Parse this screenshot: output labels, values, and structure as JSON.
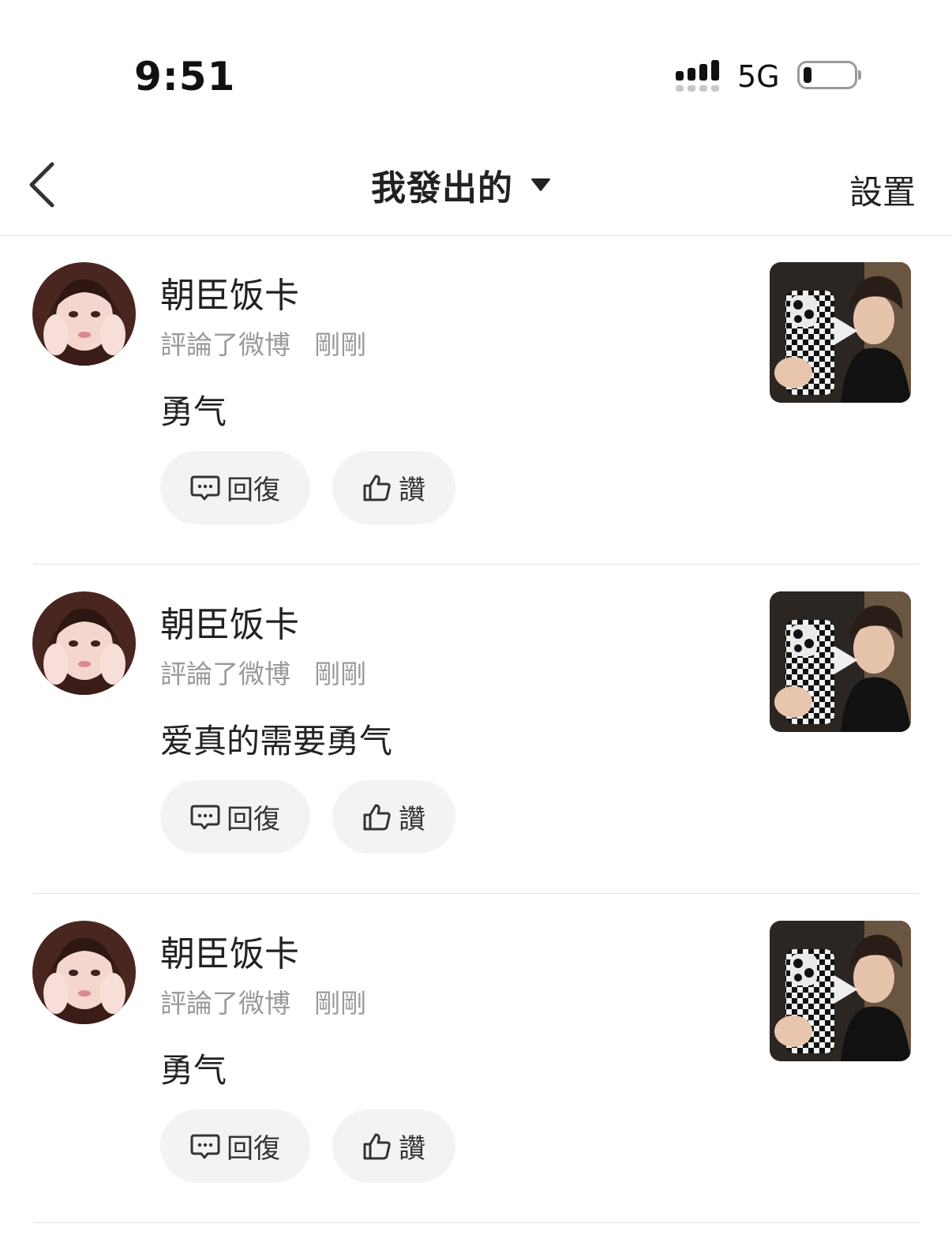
{
  "status": {
    "time": "9:51",
    "network": "5G",
    "battery_level": 0.15
  },
  "nav": {
    "title": "我發出的",
    "settings": "設置"
  },
  "feed": [
    {
      "username": "朝臣饭卡",
      "action": "評論了微博",
      "time": "剛剛",
      "comment": "勇气",
      "reply_label": "回復",
      "like_label": "讚"
    },
    {
      "username": "朝臣饭卡",
      "action": "評論了微博",
      "time": "剛剛",
      "comment": "爱真的需要勇气",
      "reply_label": "回復",
      "like_label": "讚"
    },
    {
      "username": "朝臣饭卡",
      "action": "評論了微博",
      "time": "剛剛",
      "comment": "勇气",
      "reply_label": "回復",
      "like_label": "讚"
    }
  ],
  "icons": {
    "back": "chevron-left-icon",
    "dropdown": "caret-down-icon",
    "reply": "comment-bubble-icon",
    "like": "thumbs-up-icon",
    "play": "play-icon"
  },
  "colors": {
    "text": "#222222",
    "meta": "#9a9a9a",
    "button_bg": "#f3f3f3",
    "divider": "#e6e6e6"
  }
}
